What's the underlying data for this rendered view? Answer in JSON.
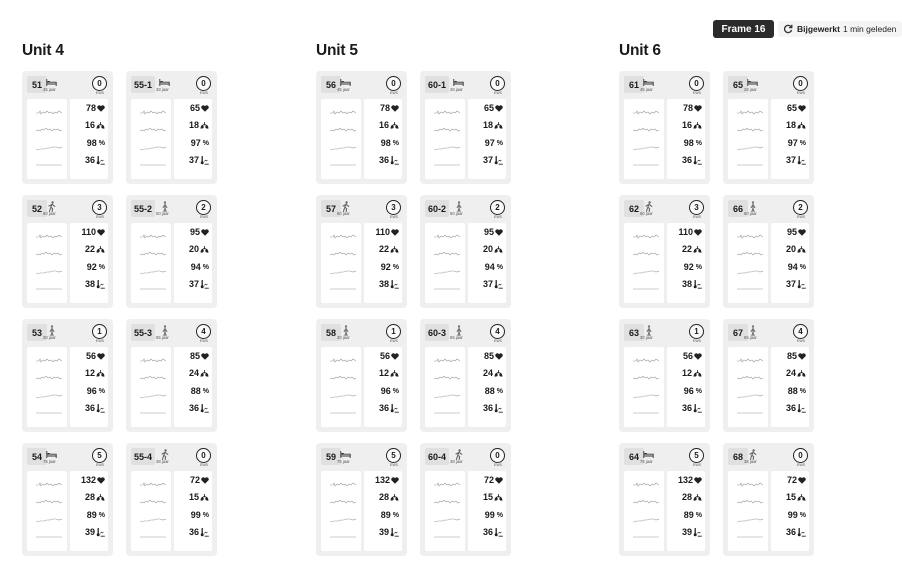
{
  "header": {
    "frame_label": "Frame 16",
    "updated_bold": "Bijgewerkt",
    "updated_rest": "1 min geleden"
  },
  "ews_label": "EWS",
  "units": [
    {
      "title": "Unit 4",
      "columns": [
        [
          {
            "room": "51",
            "position": "bed",
            "age": "45 jaar",
            "ews": "0",
            "hr": "78",
            "rr": "16",
            "spo2": "98",
            "temp": "36"
          },
          {
            "room": "52",
            "position": "walk",
            "age": "60 jaar",
            "ews": "3",
            "hr": "110",
            "rr": "22",
            "spo2": "92",
            "temp": "38"
          },
          {
            "room": "53",
            "position": "stand",
            "age": "30 jaar",
            "ews": "1",
            "hr": "56",
            "rr": "12",
            "spo2": "96",
            "temp": "36"
          },
          {
            "room": "54",
            "position": "bed",
            "age": "75 jaar",
            "ews": "5",
            "hr": "132",
            "rr": "28",
            "spo2": "89",
            "temp": "39"
          }
        ],
        [
          {
            "room": "55-1",
            "position": "bed",
            "age": "28 jaar",
            "ews": "0",
            "hr": "65",
            "rr": "18",
            "spo2": "97",
            "temp": "37"
          },
          {
            "room": "55-2",
            "position": "stand",
            "age": "50 jaar",
            "ews": "2",
            "hr": "95",
            "rr": "20",
            "spo2": "94",
            "temp": "37"
          },
          {
            "room": "55-3",
            "position": "stand",
            "age": "65 jaar",
            "ews": "4",
            "hr": "85",
            "rr": "24",
            "spo2": "88",
            "temp": "36"
          },
          {
            "room": "55-4",
            "position": "walk",
            "age": "38 jaar",
            "ews": "0",
            "hr": "72",
            "rr": "15",
            "spo2": "99",
            "temp": "36"
          }
        ]
      ]
    },
    {
      "title": "Unit 5",
      "columns": [
        [
          {
            "room": "56",
            "position": "bed",
            "age": "45 jaar",
            "ews": "0",
            "hr": "78",
            "rr": "16",
            "spo2": "98",
            "temp": "36"
          },
          {
            "room": "57",
            "position": "walk",
            "age": "60 jaar",
            "ews": "3",
            "hr": "110",
            "rr": "22",
            "spo2": "92",
            "temp": "38"
          },
          {
            "room": "58",
            "position": "stand",
            "age": "30 jaar",
            "ews": "1",
            "hr": "56",
            "rr": "12",
            "spo2": "96",
            "temp": "36"
          },
          {
            "room": "59",
            "position": "bed",
            "age": "75 jaar",
            "ews": "5",
            "hr": "132",
            "rr": "28",
            "spo2": "89",
            "temp": "39"
          }
        ],
        [
          {
            "room": "60-1",
            "position": "bed",
            "age": "28 jaar",
            "ews": "0",
            "hr": "65",
            "rr": "18",
            "spo2": "97",
            "temp": "37"
          },
          {
            "room": "60-2",
            "position": "stand",
            "age": "50 jaar",
            "ews": "2",
            "hr": "95",
            "rr": "20",
            "spo2": "94",
            "temp": "37"
          },
          {
            "room": "60-3",
            "position": "stand",
            "age": "65 jaar",
            "ews": "4",
            "hr": "85",
            "rr": "24",
            "spo2": "88",
            "temp": "36"
          },
          {
            "room": "60-4",
            "position": "walk",
            "age": "38 jaar",
            "ews": "0",
            "hr": "72",
            "rr": "15",
            "spo2": "99",
            "temp": "36"
          }
        ]
      ]
    },
    {
      "title": "Unit 6",
      "columns": [
        [
          {
            "room": "61",
            "position": "bed",
            "age": "45 jaar",
            "ews": "0",
            "hr": "78",
            "rr": "16",
            "spo2": "98",
            "temp": "36"
          },
          {
            "room": "62",
            "position": "walk",
            "age": "60 jaar",
            "ews": "3",
            "hr": "110",
            "rr": "22",
            "spo2": "92",
            "temp": "38"
          },
          {
            "room": "63",
            "position": "stand",
            "age": "30 jaar",
            "ews": "1",
            "hr": "56",
            "rr": "12",
            "spo2": "96",
            "temp": "36"
          },
          {
            "room": "64",
            "position": "bed",
            "age": "75 jaar",
            "ews": "5",
            "hr": "132",
            "rr": "28",
            "spo2": "89",
            "temp": "39"
          }
        ],
        [
          {
            "room": "65",
            "position": "bed",
            "age": "28 jaar",
            "ews": "0",
            "hr": "65",
            "rr": "18",
            "spo2": "97",
            "temp": "37"
          },
          {
            "room": "66",
            "position": "stand",
            "age": "50 jaar",
            "ews": "2",
            "hr": "95",
            "rr": "20",
            "spo2": "94",
            "temp": "37"
          },
          {
            "room": "67",
            "position": "stand",
            "age": "65 jaar",
            "ews": "4",
            "hr": "85",
            "rr": "24",
            "spo2": "88",
            "temp": "36"
          },
          {
            "room": "68",
            "position": "walk",
            "age": "38 jaar",
            "ews": "0",
            "hr": "72",
            "rr": "15",
            "spo2": "99",
            "temp": "36"
          }
        ]
      ]
    }
  ]
}
